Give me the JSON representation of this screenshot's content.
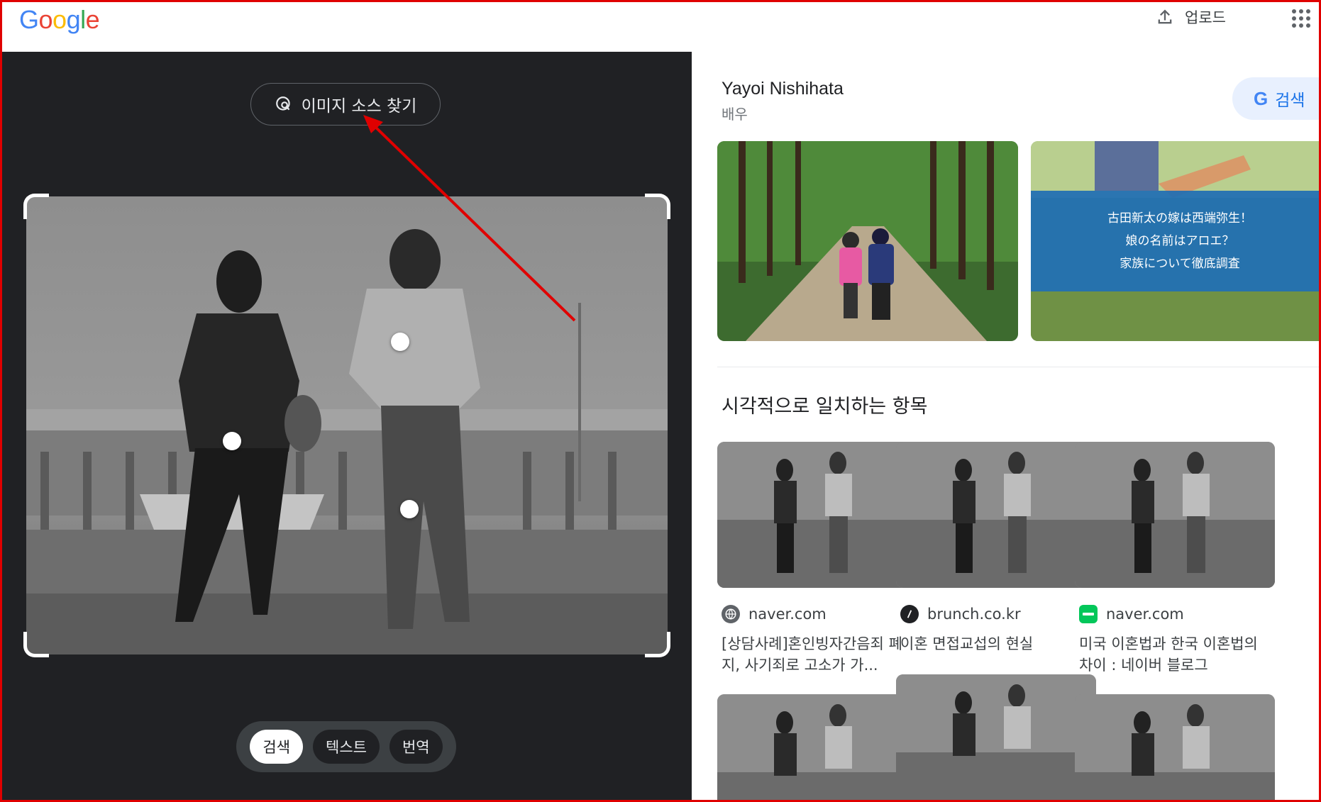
{
  "header": {
    "logo_letters": [
      {
        "ch": "G",
        "color": "#4285F4"
      },
      {
        "ch": "o",
        "color": "#EA4335"
      },
      {
        "ch": "o",
        "color": "#FBBC05"
      },
      {
        "ch": "g",
        "color": "#4285F4"
      },
      {
        "ch": "l",
        "color": "#34A853"
      },
      {
        "ch": "e",
        "color": "#EA4335"
      }
    ],
    "upload_label": "업로드"
  },
  "left": {
    "find_source_label": "이미지 소스 찾기",
    "modes": [
      "검색",
      "텍스트",
      "번역"
    ],
    "active_mode": "검색"
  },
  "right": {
    "entity_title": "Yayoi Nishihata",
    "entity_subtitle": "배우",
    "search_button_label": "검색",
    "hero2_text": [
      "古田新太の嫁は西端弥生！",
      "娘の名前はアロエ？",
      "家族について徹底調査"
    ],
    "section_title": "시각적으로 일치하는 항목",
    "results": [
      {
        "source": "naver.com",
        "icon": "globe-icon",
        "title": "[상담사례]혼인빙자간음죄 폐지, 사기죄로 고소가 가..."
      },
      {
        "source": "brunch.co.kr",
        "icon": "brunch-icon",
        "title": "이혼 면접교섭의 현실"
      },
      {
        "source": "naver.com",
        "icon": "naver-blog-icon",
        "title": "미국 이혼법과 한국 이혼법의 차이 : 네이버 블로그"
      }
    ]
  },
  "colors": {
    "accent_red": "#e00000",
    "dark_bg": "#202124",
    "google_blue": "#1a73e8",
    "naver_green": "#03c75a"
  }
}
